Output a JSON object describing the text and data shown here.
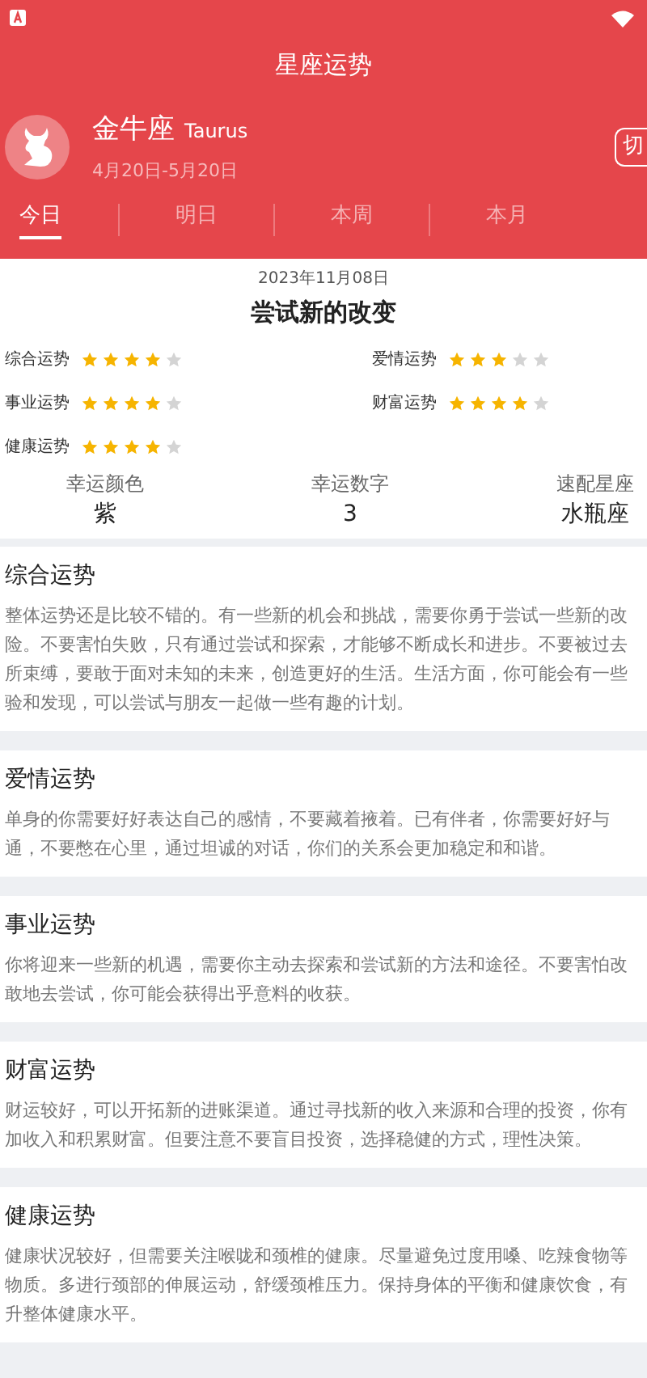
{
  "header": {
    "title": "星座运势",
    "sign": {
      "name": "金牛座",
      "latin": "Taurus",
      "dates": "4月20日-5月20日"
    },
    "switch_button": "切"
  },
  "tabs": [
    {
      "label": "今日",
      "selected": true
    },
    {
      "label": "明日",
      "selected": false
    },
    {
      "label": "本周",
      "selected": false
    },
    {
      "label": "本月",
      "selected": false
    }
  ],
  "summary": {
    "date": "2023年11月08日",
    "headline": "尝试新的改变",
    "ratings": [
      {
        "label": "综合运势",
        "stars": 4
      },
      {
        "label": "爱情运势",
        "stars": 3
      },
      {
        "label": "事业运势",
        "stars": 4
      },
      {
        "label": "财富运势",
        "stars": 4
      },
      {
        "label": "健康运势",
        "stars": 4
      }
    ],
    "lucky": [
      {
        "label": "幸运颜色",
        "value": "紫"
      },
      {
        "label": "幸运数字",
        "value": "3"
      },
      {
        "label": "速配星座",
        "value": "水瓶座"
      }
    ]
  },
  "sections": [
    {
      "title": "综合运势",
      "lines": [
        "整体运势还是比较不错的。有一些新的机会和挑战，需要你勇于尝试一些新的改",
        "险。不要害怕失败，只有通过尝试和探索，才能够不断成长和进步。不要被过去",
        "所束缚，要敢于面对未知的未来，创造更好的生活。生活方面，你可能会有一些",
        "验和发现，可以尝试与朋友一起做一些有趣的计划。"
      ]
    },
    {
      "title": "爱情运势",
      "lines": [
        "单身的你需要好好表达自己的感情，不要藏着掖着。已有伴者，你需要好好与",
        "通，不要憋在心里，通过坦诚的对话，你们的关系会更加稳定和和谐。"
      ]
    },
    {
      "title": "事业运势",
      "lines": [
        "你将迎来一些新的机遇，需要你主动去探索和尝试新的方法和途径。不要害怕改",
        "敢地去尝试，你可能会获得出乎意料的收获。"
      ]
    },
    {
      "title": "财富运势",
      "lines": [
        "财运较好，可以开拓新的进账渠道。通过寻找新的收入来源和合理的投资，你有",
        "加收入和积累财富。但要注意不要盲目投资，选择稳健的方式，理性决策。"
      ]
    },
    {
      "title": "健康运势",
      "lines": [
        "健康状况较好，但需要关注喉咙和颈椎的健康。尽量避免过度用嗓、吃辣食物等",
        "物质。多进行颈部的伸展运动，舒缓颈椎压力。保持身体的平衡和健康饮食，有",
        "升整体健康水平。"
      ]
    }
  ]
}
